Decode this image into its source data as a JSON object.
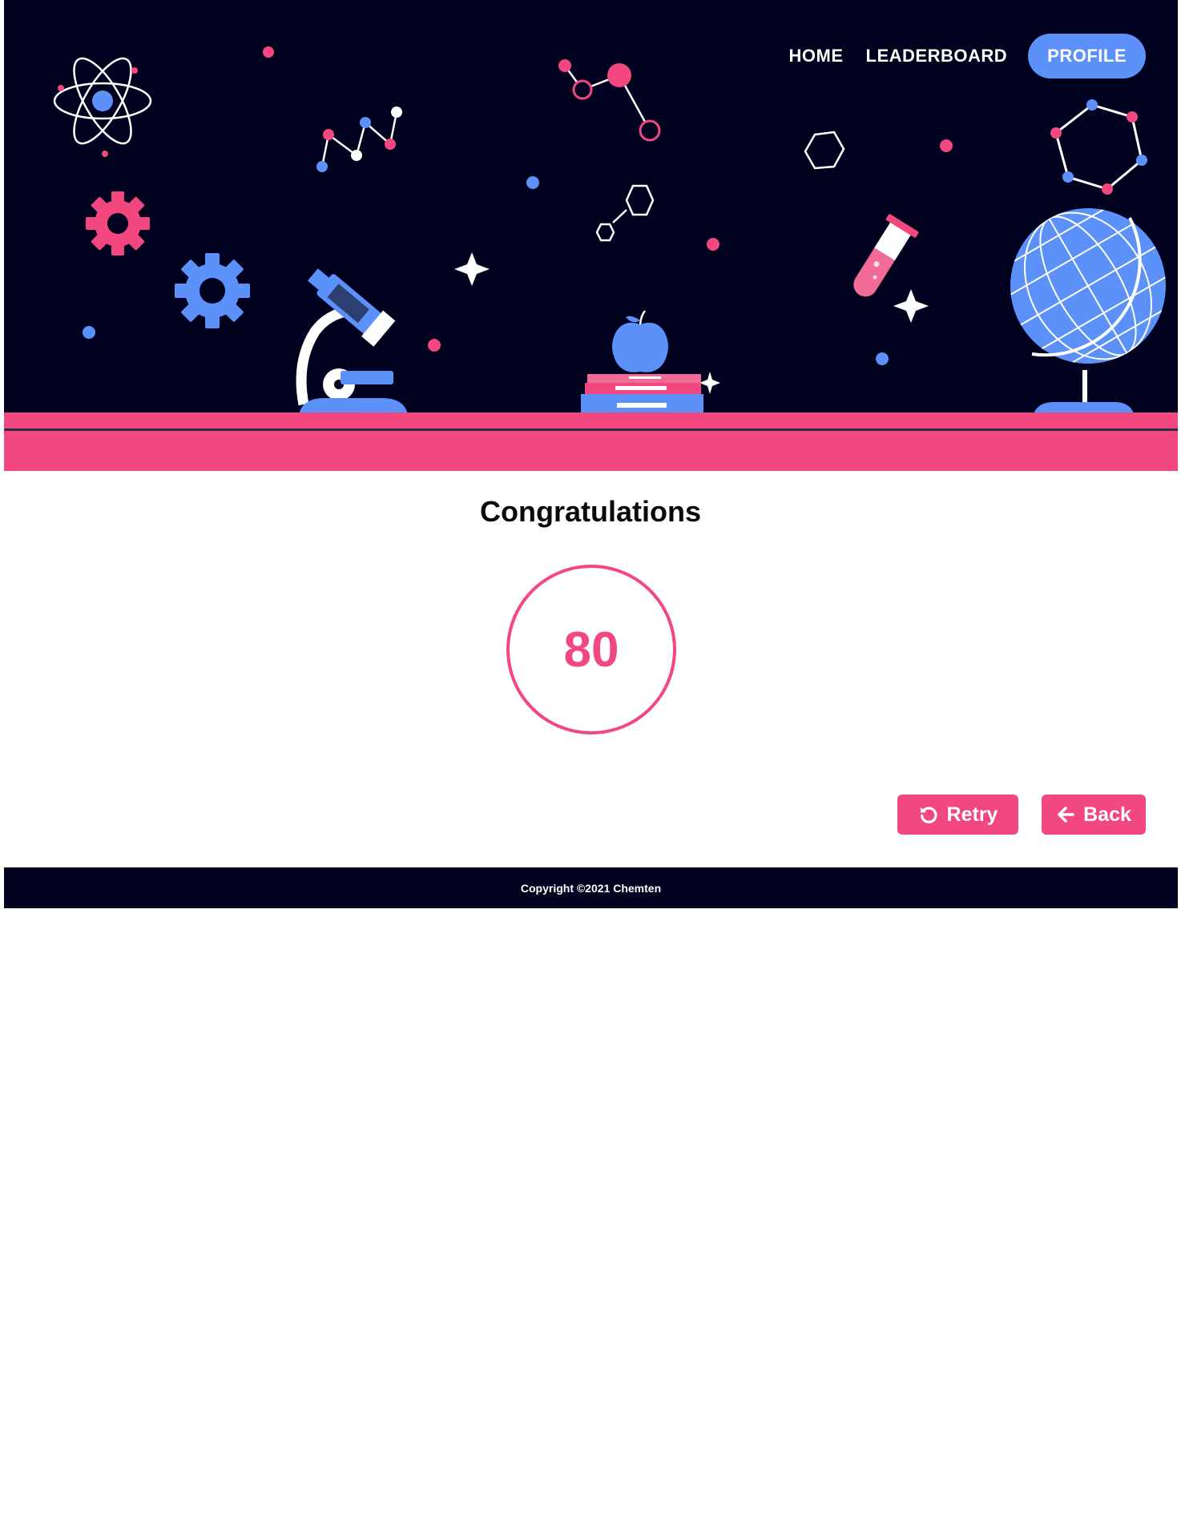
{
  "nav": {
    "home": "HOME",
    "leaderboard": "LEADERBOARD",
    "profile": "PROFILE"
  },
  "result": {
    "title": "Congratulations",
    "score": "80"
  },
  "actions": {
    "retry": "Retry",
    "back": "Back"
  },
  "footer": {
    "copyright": "Copyright ©2021 Chemten"
  },
  "icons": {
    "retry": "rotate-left-icon",
    "back": "arrow-left-icon"
  },
  "colors": {
    "navy": "#00001f",
    "pink": "#f2477f",
    "blue": "#5b91f8",
    "white": "#ffffff"
  }
}
